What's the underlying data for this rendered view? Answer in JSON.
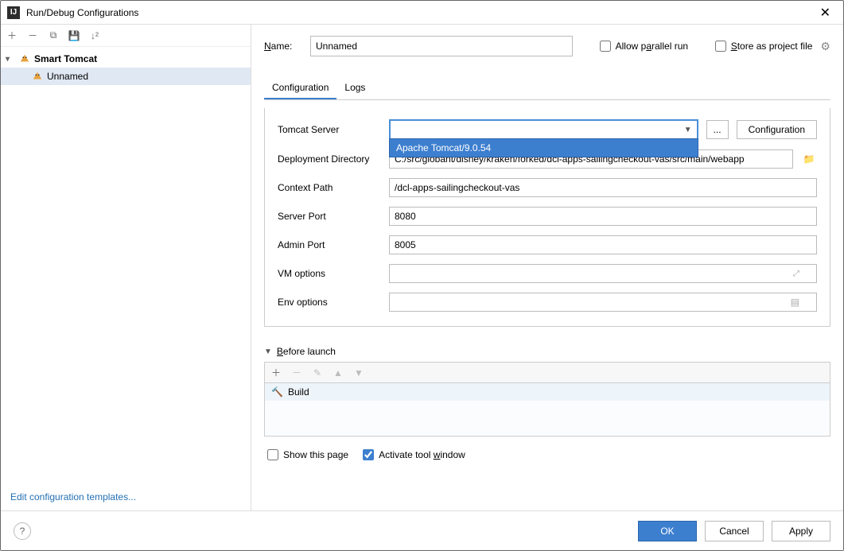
{
  "window": {
    "title": "Run/Debug Configurations"
  },
  "tree": {
    "parent": "Smart Tomcat",
    "child": "Unnamed"
  },
  "editLink": "Edit configuration templates...",
  "nameRow": {
    "label": "Name:",
    "value": "Unnamed",
    "allowParallel": "Allow parallel run",
    "storeAsFile": "Store as project file"
  },
  "tabs": {
    "config": "Configuration",
    "logs": "Logs"
  },
  "form": {
    "tomcatServer": {
      "label": "Tomcat Server",
      "option": "Apache Tomcat/9.0.54",
      "browse": "...",
      "configBtn": "Configuration"
    },
    "deployDir": {
      "label": "Deployment Directory",
      "value": "C:/src/globant/disney/kraken/forked/dcl-apps-sailingcheckout-vas/src/main/webapp"
    },
    "contextPath": {
      "label": "Context Path",
      "value": "/dcl-apps-sailingcheckout-vas"
    },
    "serverPort": {
      "label": "Server Port",
      "value": "8080"
    },
    "adminPort": {
      "label": "Admin Port",
      "value": "8005"
    },
    "vmOptions": {
      "label": "VM options",
      "value": ""
    },
    "envOptions": {
      "label": "Env options",
      "value": ""
    }
  },
  "beforeLaunch": {
    "title": "Before launch",
    "item": "Build"
  },
  "bottomChecks": {
    "showPage": "Show this page",
    "activateTool": "Activate tool window"
  },
  "footer": {
    "ok": "OK",
    "cancel": "Cancel",
    "apply": "Apply"
  }
}
